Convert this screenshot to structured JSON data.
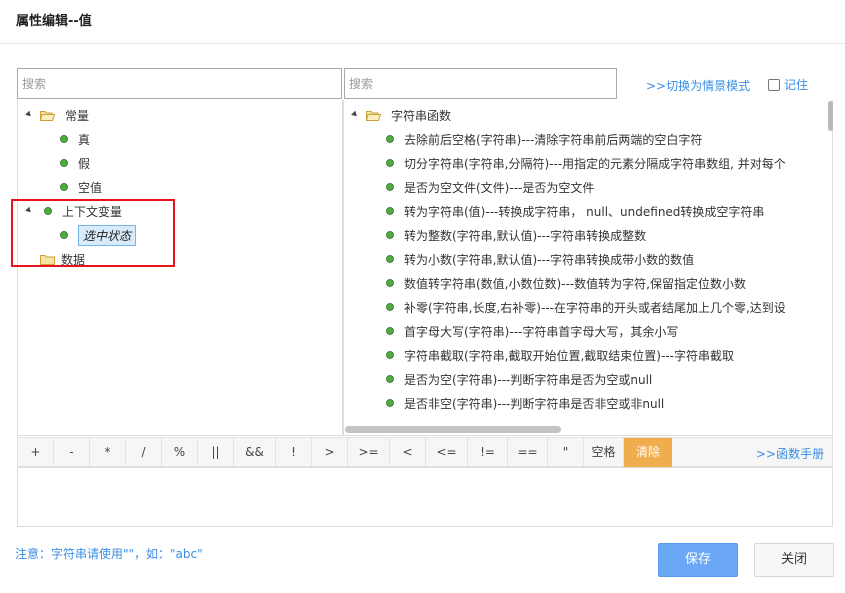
{
  "dialog": {
    "title": "属性编辑--值"
  },
  "left_tree": {
    "search_placeholder": "搜索",
    "groups": [
      {
        "label": "常量",
        "items": [
          "真",
          "假",
          "空值"
        ]
      },
      {
        "label": "上下文变量",
        "items": [
          "选中状态"
        ]
      },
      {
        "label": "数据",
        "items": []
      }
    ]
  },
  "right_tree": {
    "search_placeholder": "搜索",
    "switch_link": ">>切换为情景模式",
    "remember_label": "记住",
    "group": "字符串函数",
    "functions": [
      "去除前后空格(字符串)---清除字符串前后两端的空白字符",
      "切分字符串(字符串,分隔符)---用指定的元素分隔成字符串数组, 并对每个",
      "是否为空文件(文件)---是否为空文件",
      "转为字符串(值)---转换成字符串， null、undefined转换成空字符串",
      "转为整数(字符串,默认值)---字符串转换成整数",
      "转为小数(字符串,默认值)---字符串转换成带小数的数值",
      "数值转字符串(数值,小数位数)---数值转为字符,保留指定位数小数",
      "补零(字符串,长度,右补零)---在字符串的开头或者结尾加上几个零,达到设",
      "首字母大写(字符串)---字符串首字母大写，其余小写",
      "字符串截取(字符串,截取开始位置,截取结束位置)---字符串截取",
      "是否为空(字符串)---判断字符串是否为空或null",
      "是否非空(字符串)---判断字符串是否非空或非null"
    ]
  },
  "operators": [
    "+",
    "-",
    "*",
    "/",
    "%",
    "||",
    "&&",
    "!",
    ">",
    ">=",
    "<",
    "<=",
    "!=",
    "==",
    "\"",
    "空格",
    "清除"
  ],
  "manual_link": ">>函数手册",
  "note": "注意：字符串请使用\"\"，如：\"abc\"",
  "buttons": {
    "save": "保存",
    "close": "关闭"
  },
  "colors": {
    "accent": "#3a8ee6",
    "clear_button": "#f0ad4e",
    "save_button": "#6aa7f5",
    "highlight_box": "#e8141b",
    "leaf_dot": "#55a644"
  }
}
